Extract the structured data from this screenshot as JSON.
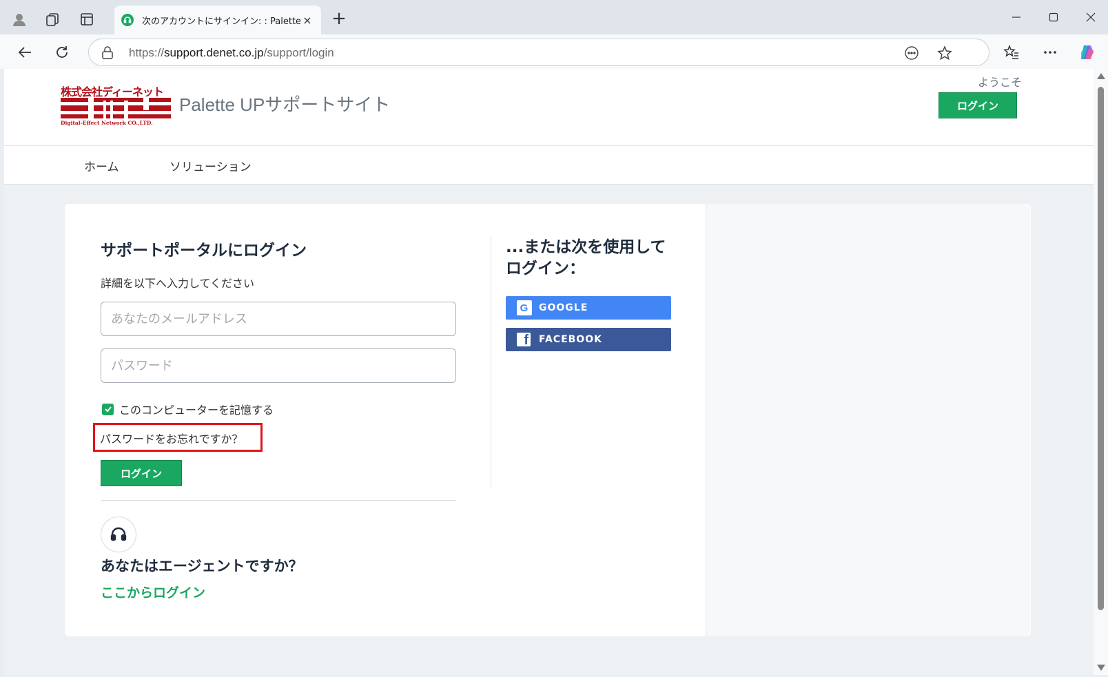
{
  "browser": {
    "tab_title": "次のアカウントにサインイン: : Palette UP",
    "tab_close": "×",
    "new_tab": "+",
    "url_prefix": "https://",
    "url_domain": "support.denet.co.jp",
    "url_path": "/support/login"
  },
  "header": {
    "logo_jp": "株式会社ディーネット",
    "logo_en": "Digital-Effect Network CO.,LTD.",
    "site_title": "Palette UPサポートサイト",
    "welcome": "ようこそ",
    "login_button": "ログイン"
  },
  "nav": {
    "items": [
      {
        "label": "ホーム"
      },
      {
        "label": "ソリューション"
      }
    ]
  },
  "login": {
    "title": "サポートポータルにログイン",
    "subtitle": "詳細を以下へ入力してください",
    "email_placeholder": "あなたのメールアドレス",
    "password_placeholder": "パスワード",
    "remember_label": "このコンピューターを記憶する",
    "remember_checked": true,
    "forgot_link": "パスワードをお忘れですか？",
    "submit_label": "ログイン",
    "agent_title": "あなたはエージェントですか？",
    "agent_link": "ここからログイン"
  },
  "alt_login": {
    "title": "...または次を使用してログイン：",
    "google_label": "GOOGLE",
    "google_badge": "G",
    "facebook_label": "FACEBOOK",
    "facebook_badge": "f"
  },
  "colors": {
    "brand_green": "#1aa861",
    "logo_red": "#b3121b",
    "google_blue": "#4286f5",
    "facebook_blue": "#3b5998",
    "highlight_red": "#e0141c"
  }
}
